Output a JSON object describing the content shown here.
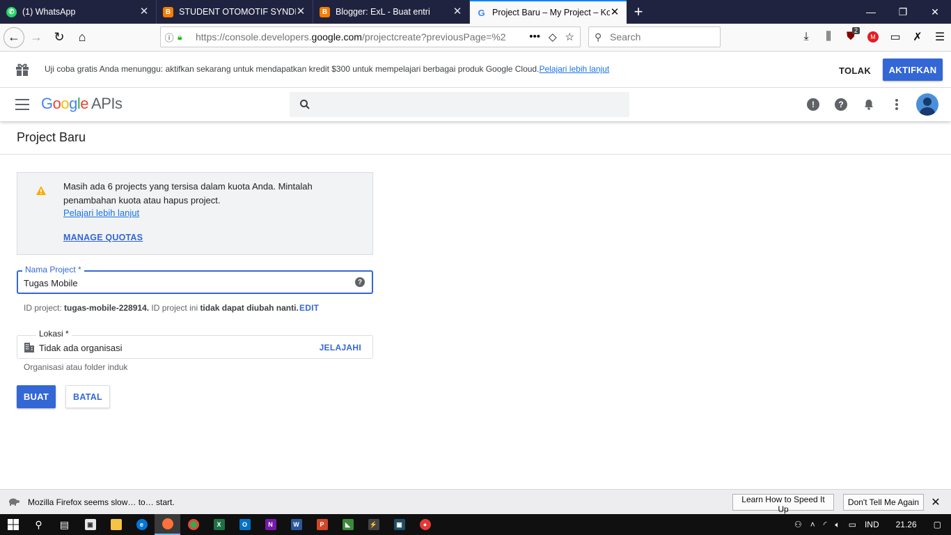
{
  "browser": {
    "tabs": [
      {
        "title": "(1) WhatsApp",
        "icon": "whatsapp-icon",
        "active": false
      },
      {
        "title": "STUDENT OTOMOTIF SYNDICATE",
        "icon": "blogger-icon",
        "active": false
      },
      {
        "title": "Blogger: ExL - Buat entri",
        "icon": "blogger-icon",
        "active": false
      },
      {
        "title": "Project Baru – My Project – Konsol",
        "icon": "google-icon",
        "active": true
      }
    ],
    "url_prefix": "https://console.developers.",
    "url_domain": "google.com",
    "url_suffix": "/projectcreate?previousPage=%2",
    "search_placeholder": "Search",
    "ext_badge": "2"
  },
  "promo": {
    "text": "Uji coba gratis Anda menunggu: aktifkan sekarang untuk mendapatkan kredit $300 untuk mempelajari berbagai produk Google Cloud.",
    "link": "Pelajari lebih lanjut",
    "decline": "TOLAK",
    "activate": "AKTIFKAN"
  },
  "header": {
    "logo_g": "G",
    "logo_o1": "o",
    "logo_o2": "o",
    "logo_g2": "g",
    "logo_l": "l",
    "logo_e": "e",
    "logo_apis": "APIs",
    "search_value": ""
  },
  "page": {
    "title": "Project Baru",
    "quota_text": "Masih ada 6 projects yang tersisa dalam kuota Anda. Mintalah penambahan kuota atau hapus project.",
    "quota_link": "Pelajari lebih lanjut",
    "manage_quotas": "MANAGE QUOTAS",
    "name_label": "Nama Project *",
    "name_value": "Tugas Mobile",
    "pid_prefix": "ID project: ",
    "pid_value": "tugas-mobile-228914.",
    "pid_middle": " ID project ini ",
    "pid_bold": "tidak dapat diubah nanti.",
    "pid_edit": "EDIT",
    "loc_label": "Lokasi *",
    "loc_value": "Tidak ada organisasi",
    "loc_browse": "JELAJAHI",
    "loc_hint": "Organisasi atau folder induk",
    "create": "BUAT",
    "cancel": "BATAL"
  },
  "notification": {
    "text": "Mozilla Firefox seems slow… to… start.",
    "learn": "Learn How to Speed It Up",
    "dismiss": "Don't Tell Me Again"
  },
  "taskbar": {
    "lang": "IND",
    "time": "21.26"
  },
  "colors": {
    "accent": "#3367d6",
    "tabbar": "#202340",
    "warning": "#f9ab00"
  }
}
